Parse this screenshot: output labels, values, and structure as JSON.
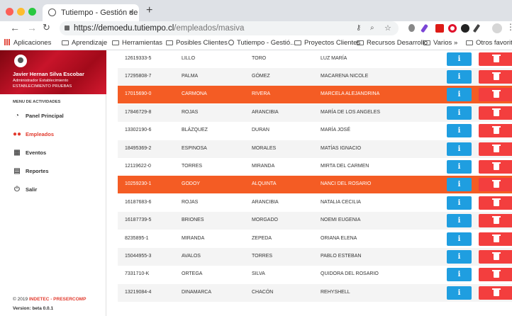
{
  "browser": {
    "tab_title": "Tutiempo - Gestión de Asistencia",
    "url_host": "https://demoedu.tutiempo.cl",
    "url_path": "/empleados/masiva",
    "bookmarks": [
      "Aplicaciones",
      "Aprendizaje",
      "Herramientas",
      "Posibles Clientes",
      "Tutiempo - Gestió...",
      "Proyectos Clientes",
      "Recursos Desarrollo",
      "Varios",
      "»",
      "Otros favoritos"
    ]
  },
  "sidebar": {
    "user_name": "Javier Hernan Silva Escobar",
    "user_role": "Administrador Establecimiento",
    "establishment": "ESTABLECIMIENTO PRUEBAS",
    "menu_header": "MENU DE ACTIVIDADES",
    "items": [
      {
        "label": "Panel Principal",
        "icon": "dashboard-icon"
      },
      {
        "label": "Empleados",
        "icon": "users-icon"
      },
      {
        "label": "Eventos",
        "icon": "calendar-icon"
      },
      {
        "label": "Reportes",
        "icon": "document-icon"
      },
      {
        "label": "Salir",
        "icon": "power-icon"
      }
    ],
    "footer_year": "© 2019",
    "footer_brand": "INDETEC - PRESERCOMP",
    "version": "Version: beta 0.0.1"
  },
  "colors": {
    "selected_row": "#f45c24",
    "info_button": "#1f9ee0",
    "delete_button": "#f33e3e",
    "accent": "#e23b2e"
  },
  "table": {
    "rows": [
      {
        "rut": "12619333-5",
        "apellido_p": "LILLO",
        "apellido_m": "TORO",
        "nombres": "LUZ MARÍA",
        "selected": false
      },
      {
        "rut": "17295808-7",
        "apellido_p": "PALMA",
        "apellido_m": "GÓMEZ",
        "nombres": "MACARENA NICOLE",
        "selected": false
      },
      {
        "rut": "17015690-0",
        "apellido_p": "CARMONA",
        "apellido_m": "RIVERA",
        "nombres": "MARCELA ALEJANDRINA",
        "selected": true
      },
      {
        "rut": "17846729-8",
        "apellido_p": "ROJAS",
        "apellido_m": "ARANCIBIA",
        "nombres": "MARÍA DE LOS ANGELES",
        "selected": false
      },
      {
        "rut": "13302190-6",
        "apellido_p": "BLÁZQUEZ",
        "apellido_m": "DURAN",
        "nombres": "MARÍA JOSÉ",
        "selected": false
      },
      {
        "rut": "18495369-2",
        "apellido_p": "ESPINOSA",
        "apellido_m": "MORALES",
        "nombres": "MATÍAS IGNACIO",
        "selected": false
      },
      {
        "rut": "12119622-0",
        "apellido_p": "TORRES",
        "apellido_m": "MIRANDA",
        "nombres": "MIRTA DEL CARMEN",
        "selected": false
      },
      {
        "rut": "10259230-1",
        "apellido_p": "GODOY",
        "apellido_m": "ALQUINTA",
        "nombres": "NANCI DEL ROSARIO",
        "selected": true
      },
      {
        "rut": "16187683-6",
        "apellido_p": "ROJAS",
        "apellido_m": "ARANCIBIA",
        "nombres": "NATALIA CECILIA",
        "selected": false
      },
      {
        "rut": "16187739-5",
        "apellido_p": "BRIONES",
        "apellido_m": "MORGADO",
        "nombres": "NOEMI EUGENIA",
        "selected": false
      },
      {
        "rut": "8235895-1",
        "apellido_p": "MIRANDA",
        "apellido_m": "ZEPEDA",
        "nombres": "ORIANA ELENA",
        "selected": false
      },
      {
        "rut": "15044955-3",
        "apellido_p": "AVALOS",
        "apellido_m": "TORRES",
        "nombres": "PABLO ESTEBAN",
        "selected": false
      },
      {
        "rut": "7331710-K",
        "apellido_p": "ORTEGA",
        "apellido_m": "SILVA",
        "nombres": "QUIDORA DEL ROSARIO",
        "selected": false
      },
      {
        "rut": "13219084-4",
        "apellido_p": "DINAMARCA",
        "apellido_m": "CHACÓN",
        "nombres": "REHYSHELL",
        "selected": false
      }
    ],
    "info_label": "i"
  }
}
